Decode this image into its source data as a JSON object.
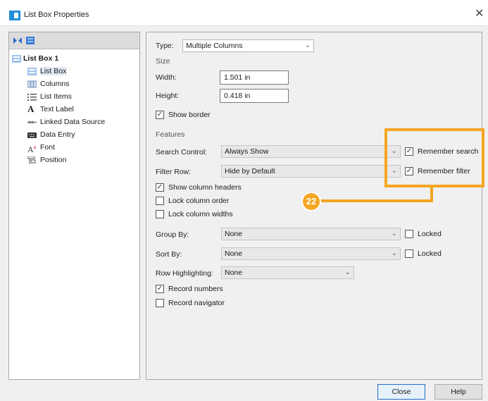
{
  "window": {
    "title": "List Box Properties"
  },
  "tree": {
    "root": "List Box 1",
    "items": [
      {
        "label": "List Box",
        "icon": "listbox-icon",
        "selected": true
      },
      {
        "label": "Columns",
        "icon": "columns-icon"
      },
      {
        "label": "List Items",
        "icon": "list-items-icon"
      },
      {
        "label": "Text Label",
        "icon": "text-label-icon"
      },
      {
        "label": "Linked Data Source",
        "icon": "link-icon"
      },
      {
        "label": "Data Entry",
        "icon": "data-entry-icon"
      },
      {
        "label": "Font",
        "icon": "font-icon"
      },
      {
        "label": "Position",
        "icon": "position-icon"
      }
    ]
  },
  "props": {
    "type_label": "Type:",
    "type_value": "Multiple Columns",
    "size_section": "Size",
    "width_label": "Width:",
    "width_value": "1.501 in",
    "height_label": "Height:",
    "height_value": "0.418 in",
    "show_border": "Show border",
    "features_section": "Features",
    "search_label": "Search Control:",
    "search_value": "Always Show",
    "remember_search": "Remember search",
    "filter_label": "Filter Row:",
    "filter_value": "Hide by Default",
    "remember_filter": "Remember filter",
    "show_headers": "Show column headers",
    "lock_order": "Lock column order",
    "lock_widths": "Lock column widths",
    "group_label": "Group By:",
    "group_value": "None",
    "group_locked": "Locked",
    "sort_label": "Sort By:",
    "sort_value": "None",
    "sort_locked": "Locked",
    "highlight_label": "Row Highlighting:",
    "highlight_value": "None",
    "record_numbers": "Record numbers",
    "record_navigator": "Record navigator"
  },
  "checks": {
    "show_border": true,
    "remember_search": true,
    "remember_filter": true,
    "show_headers": true,
    "lock_order": false,
    "lock_widths": false,
    "group_locked": false,
    "sort_locked": false,
    "record_numbers": true,
    "record_navigator": false
  },
  "callout": {
    "number": "22",
    "color": "#f5a623"
  },
  "buttons": {
    "close": "Close",
    "help": "Help"
  }
}
